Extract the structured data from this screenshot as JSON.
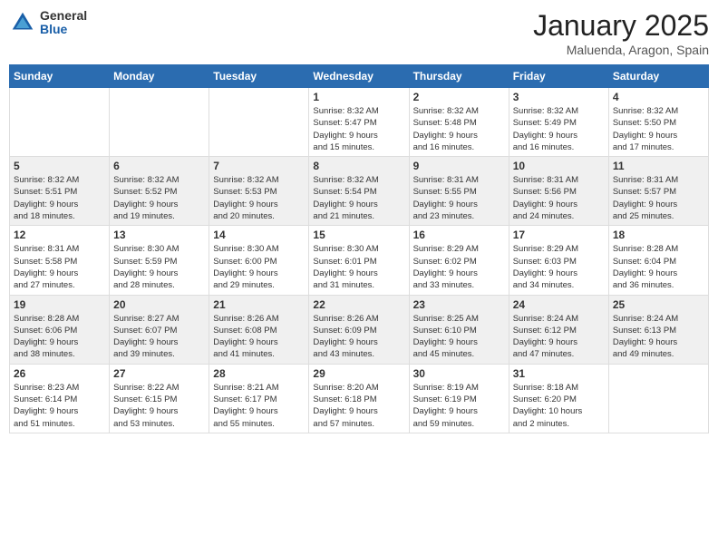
{
  "header": {
    "logo": {
      "general": "General",
      "blue": "Blue"
    },
    "title": "January 2025",
    "subtitle": "Maluenda, Aragon, Spain"
  },
  "calendar": {
    "days_of_week": [
      "Sunday",
      "Monday",
      "Tuesday",
      "Wednesday",
      "Thursday",
      "Friday",
      "Saturday"
    ],
    "weeks": [
      [
        {
          "day": "",
          "info": ""
        },
        {
          "day": "",
          "info": ""
        },
        {
          "day": "",
          "info": ""
        },
        {
          "day": "1",
          "info": "Sunrise: 8:32 AM\nSunset: 5:47 PM\nDaylight: 9 hours\nand 15 minutes."
        },
        {
          "day": "2",
          "info": "Sunrise: 8:32 AM\nSunset: 5:48 PM\nDaylight: 9 hours\nand 16 minutes."
        },
        {
          "day": "3",
          "info": "Sunrise: 8:32 AM\nSunset: 5:49 PM\nDaylight: 9 hours\nand 16 minutes."
        },
        {
          "day": "4",
          "info": "Sunrise: 8:32 AM\nSunset: 5:50 PM\nDaylight: 9 hours\nand 17 minutes."
        }
      ],
      [
        {
          "day": "5",
          "info": "Sunrise: 8:32 AM\nSunset: 5:51 PM\nDaylight: 9 hours\nand 18 minutes."
        },
        {
          "day": "6",
          "info": "Sunrise: 8:32 AM\nSunset: 5:52 PM\nDaylight: 9 hours\nand 19 minutes."
        },
        {
          "day": "7",
          "info": "Sunrise: 8:32 AM\nSunset: 5:53 PM\nDaylight: 9 hours\nand 20 minutes."
        },
        {
          "day": "8",
          "info": "Sunrise: 8:32 AM\nSunset: 5:54 PM\nDaylight: 9 hours\nand 21 minutes."
        },
        {
          "day": "9",
          "info": "Sunrise: 8:31 AM\nSunset: 5:55 PM\nDaylight: 9 hours\nand 23 minutes."
        },
        {
          "day": "10",
          "info": "Sunrise: 8:31 AM\nSunset: 5:56 PM\nDaylight: 9 hours\nand 24 minutes."
        },
        {
          "day": "11",
          "info": "Sunrise: 8:31 AM\nSunset: 5:57 PM\nDaylight: 9 hours\nand 25 minutes."
        }
      ],
      [
        {
          "day": "12",
          "info": "Sunrise: 8:31 AM\nSunset: 5:58 PM\nDaylight: 9 hours\nand 27 minutes."
        },
        {
          "day": "13",
          "info": "Sunrise: 8:30 AM\nSunset: 5:59 PM\nDaylight: 9 hours\nand 28 minutes."
        },
        {
          "day": "14",
          "info": "Sunrise: 8:30 AM\nSunset: 6:00 PM\nDaylight: 9 hours\nand 29 minutes."
        },
        {
          "day": "15",
          "info": "Sunrise: 8:30 AM\nSunset: 6:01 PM\nDaylight: 9 hours\nand 31 minutes."
        },
        {
          "day": "16",
          "info": "Sunrise: 8:29 AM\nSunset: 6:02 PM\nDaylight: 9 hours\nand 33 minutes."
        },
        {
          "day": "17",
          "info": "Sunrise: 8:29 AM\nSunset: 6:03 PM\nDaylight: 9 hours\nand 34 minutes."
        },
        {
          "day": "18",
          "info": "Sunrise: 8:28 AM\nSunset: 6:04 PM\nDaylight: 9 hours\nand 36 minutes."
        }
      ],
      [
        {
          "day": "19",
          "info": "Sunrise: 8:28 AM\nSunset: 6:06 PM\nDaylight: 9 hours\nand 38 minutes."
        },
        {
          "day": "20",
          "info": "Sunrise: 8:27 AM\nSunset: 6:07 PM\nDaylight: 9 hours\nand 39 minutes."
        },
        {
          "day": "21",
          "info": "Sunrise: 8:26 AM\nSunset: 6:08 PM\nDaylight: 9 hours\nand 41 minutes."
        },
        {
          "day": "22",
          "info": "Sunrise: 8:26 AM\nSunset: 6:09 PM\nDaylight: 9 hours\nand 43 minutes."
        },
        {
          "day": "23",
          "info": "Sunrise: 8:25 AM\nSunset: 6:10 PM\nDaylight: 9 hours\nand 45 minutes."
        },
        {
          "day": "24",
          "info": "Sunrise: 8:24 AM\nSunset: 6:12 PM\nDaylight: 9 hours\nand 47 minutes."
        },
        {
          "day": "25",
          "info": "Sunrise: 8:24 AM\nSunset: 6:13 PM\nDaylight: 9 hours\nand 49 minutes."
        }
      ],
      [
        {
          "day": "26",
          "info": "Sunrise: 8:23 AM\nSunset: 6:14 PM\nDaylight: 9 hours\nand 51 minutes."
        },
        {
          "day": "27",
          "info": "Sunrise: 8:22 AM\nSunset: 6:15 PM\nDaylight: 9 hours\nand 53 minutes."
        },
        {
          "day": "28",
          "info": "Sunrise: 8:21 AM\nSunset: 6:17 PM\nDaylight: 9 hours\nand 55 minutes."
        },
        {
          "day": "29",
          "info": "Sunrise: 8:20 AM\nSunset: 6:18 PM\nDaylight: 9 hours\nand 57 minutes."
        },
        {
          "day": "30",
          "info": "Sunrise: 8:19 AM\nSunset: 6:19 PM\nDaylight: 9 hours\nand 59 minutes."
        },
        {
          "day": "31",
          "info": "Sunrise: 8:18 AM\nSunset: 6:20 PM\nDaylight: 10 hours\nand 2 minutes."
        },
        {
          "day": "",
          "info": ""
        }
      ]
    ]
  }
}
